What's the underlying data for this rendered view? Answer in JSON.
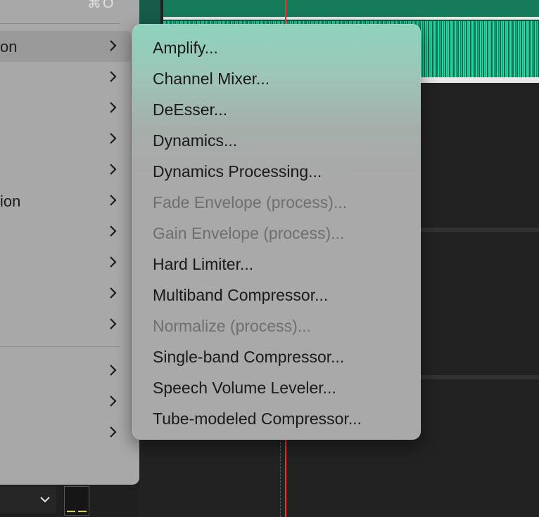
{
  "parent_menu": {
    "shortcut": "⌘O",
    "items": [
      {
        "label": "on"
      },
      {
        "label": ""
      },
      {
        "label": ""
      },
      {
        "label": ""
      },
      {
        "label": ""
      },
      {
        "label": "ion"
      },
      {
        "label": ""
      },
      {
        "label": ""
      },
      {
        "label": ""
      },
      {
        "label": ""
      },
      {
        "label": ""
      },
      {
        "label": ""
      },
      {
        "label": ""
      }
    ]
  },
  "submenu": {
    "items": [
      {
        "label": "Amplify...",
        "enabled": true
      },
      {
        "label": "Channel Mixer...",
        "enabled": true
      },
      {
        "label": "DeEsser...",
        "enabled": true
      },
      {
        "label": "Dynamics...",
        "enabled": true
      },
      {
        "label": "Dynamics Processing...",
        "enabled": true
      },
      {
        "label": "Fade Envelope (process)...",
        "enabled": false
      },
      {
        "label": "Gain Envelope (process)...",
        "enabled": false
      },
      {
        "label": "Hard Limiter...",
        "enabled": true
      },
      {
        "label": "Multiband Compressor...",
        "enabled": true
      },
      {
        "label": "Normalize (process)...",
        "enabled": false
      },
      {
        "label": "Single-band Compressor...",
        "enabled": true
      },
      {
        "label": "Speech Volume Leveler...",
        "enabled": true
      },
      {
        "label": "Tube-modeled Compressor...",
        "enabled": true
      }
    ]
  },
  "colors": {
    "waveform": "#1fd9a0",
    "playhead": "#e23838",
    "meter": "#d9d92a"
  }
}
